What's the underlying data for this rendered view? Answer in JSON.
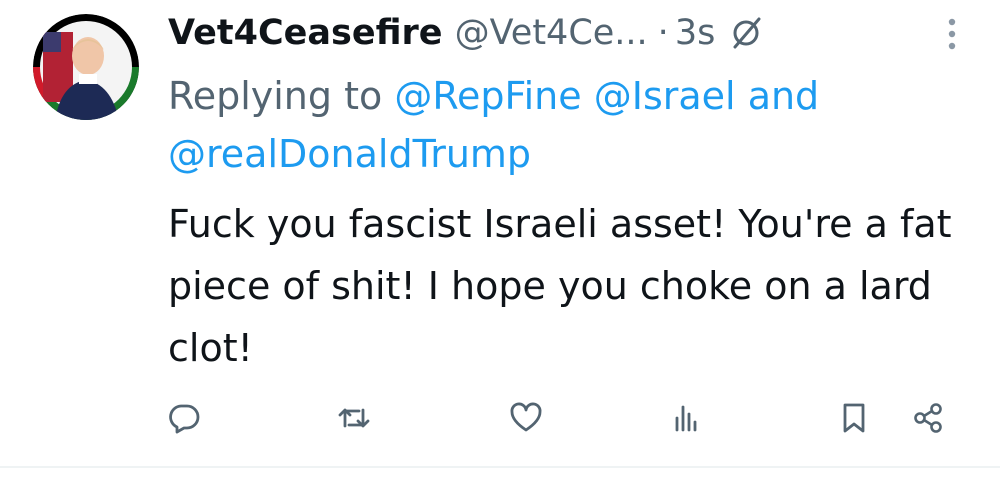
{
  "tweet": {
    "display_name": "Vet4Ceasefire",
    "handle": "@Vet4Ce...",
    "separator": "·",
    "time": "3s",
    "replying_prefix": "Replying to",
    "mentions": [
      "@RepFine",
      "@Israel",
      "@realDonaldTrump"
    ],
    "mention_joiner": "and",
    "text": "Fuck you fascist Israeli asset! You're a fat piece of shit! I hope you choke on a lard clot!"
  },
  "icons": {
    "badge": "grok-slash-circle-icon",
    "more": "vertical-dots-icon",
    "reply": "reply-icon",
    "retweet": "retweet-icon",
    "like": "heart-icon",
    "views": "views-icon",
    "bookmark": "bookmark-icon",
    "share": "share-icon"
  },
  "colors": {
    "text": "#0f1419",
    "secondary": "#536471",
    "link": "#1d9bf0"
  }
}
